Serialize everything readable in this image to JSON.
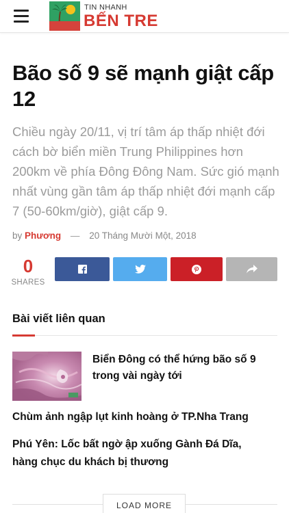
{
  "header": {
    "menu_icon": "hamburger-menu-icon",
    "logo": {
      "top_text": "TIN NHANH",
      "main_text": "BẾN TRE",
      "badge_text": "Tin Nhanh Bến Tre",
      "brand_color": "#d63a32",
      "badge_color": "#2fa163"
    }
  },
  "article": {
    "title": "Bão số 9 sẽ mạnh giật cấp 12",
    "summary": "Chiều ngày 20/11, vị trí tâm áp thấp nhiệt đới cách bờ biển miền Trung Philippines hơn 200km về phía Đông Đông Nam. Sức gió mạnh nhất vùng gần tâm áp thấp nhiệt đới mạnh cấp 7 (50-60km/giờ), giật cấp 9.",
    "meta": {
      "by": "by",
      "author": "Phương",
      "dash": "—",
      "date": "20 Tháng Mười Một, 2018"
    }
  },
  "share": {
    "count": "0",
    "label": "SHARES",
    "buttons": [
      {
        "network": "facebook",
        "icon": "facebook-icon",
        "color": "#3b5998"
      },
      {
        "network": "twitter",
        "icon": "twitter-icon",
        "color": "#55acee"
      },
      {
        "network": "pinterest",
        "icon": "pinterest-icon",
        "color": "#cb2027"
      },
      {
        "network": "share",
        "icon": "share-arrow-icon",
        "color": "#b5b5b5"
      }
    ]
  },
  "related": {
    "heading": "Bài viết liên quan",
    "items": [
      {
        "title": "Biển Đông có thể hứng bão số 9 trong vài ngày tới",
        "has_thumbnail": true
      },
      {
        "title": "Chùm ảnh ngập lụt kinh hoàng ở TP.Nha Trang"
      },
      {
        "title": "Phú Yên: Lốc bất ngờ ập xuống Gành Đá Dĩa, hàng chục du khách bị thương"
      }
    ],
    "load_more": "LOAD MORE",
    "accent_color": "#d63a32"
  }
}
